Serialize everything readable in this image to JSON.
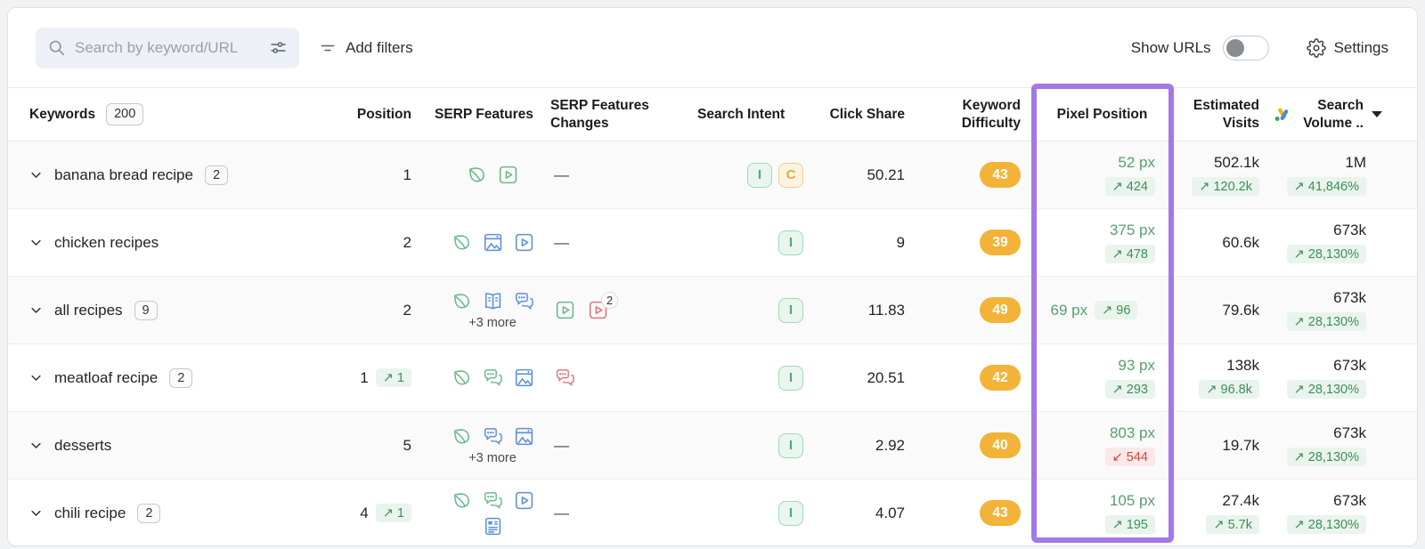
{
  "toolbar": {
    "search_placeholder": "Search by keyword/URL",
    "add_filters": "Add filters",
    "show_urls": "Show URLs",
    "show_urls_enabled": false,
    "settings": "Settings"
  },
  "header": {
    "keywords": "Keywords",
    "keywords_count": "200",
    "position": "Position",
    "serp_features": "SERP Features",
    "serp_changes": "SERP Features Changes",
    "search_intent": "Search Intent",
    "click_share": "Click Share",
    "keyword_difficulty": "Keyword Difficulty",
    "pixel_position": "Pixel Position",
    "estimated_visits": "Estimated Visits",
    "search_volume": "Search Volume .."
  },
  "table_meta": {
    "no_change": "—",
    "highlighted_column": "Pixel Position"
  },
  "colors": {
    "highlight_purple": "#a478e8",
    "kd_pill": "#f2b338",
    "positive_green": "#3e8e5c",
    "negative_red": "#cc4747",
    "icon_green": "#6ab889",
    "icon_blue": "#5d8fd8",
    "icon_red": "#e0737c"
  },
  "rows": [
    {
      "keyword": "banana bread recipe",
      "count": "2",
      "position": "1",
      "position_change": null,
      "serp_features": [
        {
          "icon": "leaf",
          "color": "green"
        },
        {
          "icon": "video",
          "color": "green"
        }
      ],
      "serp_second_row": null,
      "serp_more": null,
      "changes": null,
      "intents": [
        {
          "label": "I",
          "style": "green"
        },
        {
          "label": "C",
          "style": "orange"
        }
      ],
      "click_share": "50.21",
      "difficulty": "43",
      "pixel": {
        "value": "52 px",
        "change": "424",
        "direction": "up",
        "inline": false
      },
      "visits": {
        "value": "502.1k",
        "change": "120.2k",
        "direction": "up"
      },
      "volume": {
        "value": "1M",
        "change": "41,846%",
        "direction": "up"
      }
    },
    {
      "keyword": "chicken recipes",
      "count": null,
      "position": "2",
      "position_change": null,
      "serp_features": [
        {
          "icon": "leaf",
          "color": "green"
        },
        {
          "icon": "image",
          "color": "blue"
        },
        {
          "icon": "video",
          "color": "blue"
        }
      ],
      "serp_second_row": null,
      "serp_more": null,
      "changes": null,
      "intents": [
        {
          "label": "I",
          "style": "green"
        }
      ],
      "click_share": "9",
      "difficulty": "39",
      "pixel": {
        "value": "375 px",
        "change": "478",
        "direction": "up",
        "inline": false
      },
      "visits": {
        "value": "60.6k",
        "change": null,
        "direction": null
      },
      "volume": {
        "value": "673k",
        "change": "28,130%",
        "direction": "up"
      }
    },
    {
      "keyword": "all recipes",
      "count": "9",
      "position": "2",
      "position_change": null,
      "serp_features": [
        {
          "icon": "leaf",
          "color": "green"
        },
        {
          "icon": "book",
          "color": "blue"
        },
        {
          "icon": "discussions",
          "color": "blue"
        }
      ],
      "serp_second_row": null,
      "serp_more": "+3 more",
      "changes": [
        {
          "icon": "video",
          "color": "green"
        },
        {
          "icon": "video",
          "color": "red",
          "badge": "2"
        }
      ],
      "intents": [
        {
          "label": "I",
          "style": "green"
        }
      ],
      "click_share": "11.83",
      "difficulty": "49",
      "pixel": {
        "value": "69 px",
        "change": "96",
        "direction": "up",
        "inline": true
      },
      "visits": {
        "value": "79.6k",
        "change": null,
        "direction": null
      },
      "volume": {
        "value": "673k",
        "change": "28,130%",
        "direction": "up"
      }
    },
    {
      "keyword": "meatloaf recipe",
      "count": "2",
      "position": "1",
      "position_change": {
        "value": "1",
        "direction": "up"
      },
      "serp_features": [
        {
          "icon": "leaf",
          "color": "green"
        },
        {
          "icon": "discussions",
          "color": "green"
        },
        {
          "icon": "image",
          "color": "blue"
        }
      ],
      "serp_second_row": null,
      "serp_more": null,
      "changes": [
        {
          "icon": "discussions",
          "color": "red"
        }
      ],
      "intents": [
        {
          "label": "I",
          "style": "green"
        }
      ],
      "click_share": "20.51",
      "difficulty": "42",
      "pixel": {
        "value": "93 px",
        "change": "293",
        "direction": "up",
        "inline": false
      },
      "visits": {
        "value": "138k",
        "change": "96.8k",
        "direction": "up"
      },
      "volume": {
        "value": "673k",
        "change": "28,130%",
        "direction": "up"
      }
    },
    {
      "keyword": "desserts",
      "count": null,
      "position": "5",
      "position_change": null,
      "serp_features": [
        {
          "icon": "leaf",
          "color": "green"
        },
        {
          "icon": "discussions",
          "color": "blue"
        },
        {
          "icon": "image",
          "color": "blue"
        }
      ],
      "serp_second_row": null,
      "serp_more": "+3 more",
      "changes": null,
      "intents": [
        {
          "label": "I",
          "style": "green"
        }
      ],
      "click_share": "2.92",
      "difficulty": "40",
      "pixel": {
        "value": "803 px",
        "change": "544",
        "direction": "down",
        "inline": false
      },
      "visits": {
        "value": "19.7k",
        "change": null,
        "direction": null
      },
      "volume": {
        "value": "673k",
        "change": "28,130%",
        "direction": "up"
      }
    },
    {
      "keyword": "chili recipe",
      "count": "2",
      "position": "4",
      "position_change": {
        "value": "1",
        "direction": "up"
      },
      "serp_features": [
        {
          "icon": "leaf",
          "color": "green"
        },
        {
          "icon": "discussions",
          "color": "green"
        },
        {
          "icon": "video",
          "color": "blue"
        }
      ],
      "serp_second_row": [
        {
          "icon": "snippet",
          "color": "blue"
        }
      ],
      "serp_more": null,
      "changes": null,
      "intents": [
        {
          "label": "I",
          "style": "green"
        }
      ],
      "click_share": "4.07",
      "difficulty": "43",
      "pixel": {
        "value": "105 px",
        "change": "195",
        "direction": "up",
        "inline": false
      },
      "visits": {
        "value": "27.4k",
        "change": "5.7k",
        "direction": "up"
      },
      "volume": {
        "value": "673k",
        "change": "28,130%",
        "direction": "up"
      }
    }
  ]
}
